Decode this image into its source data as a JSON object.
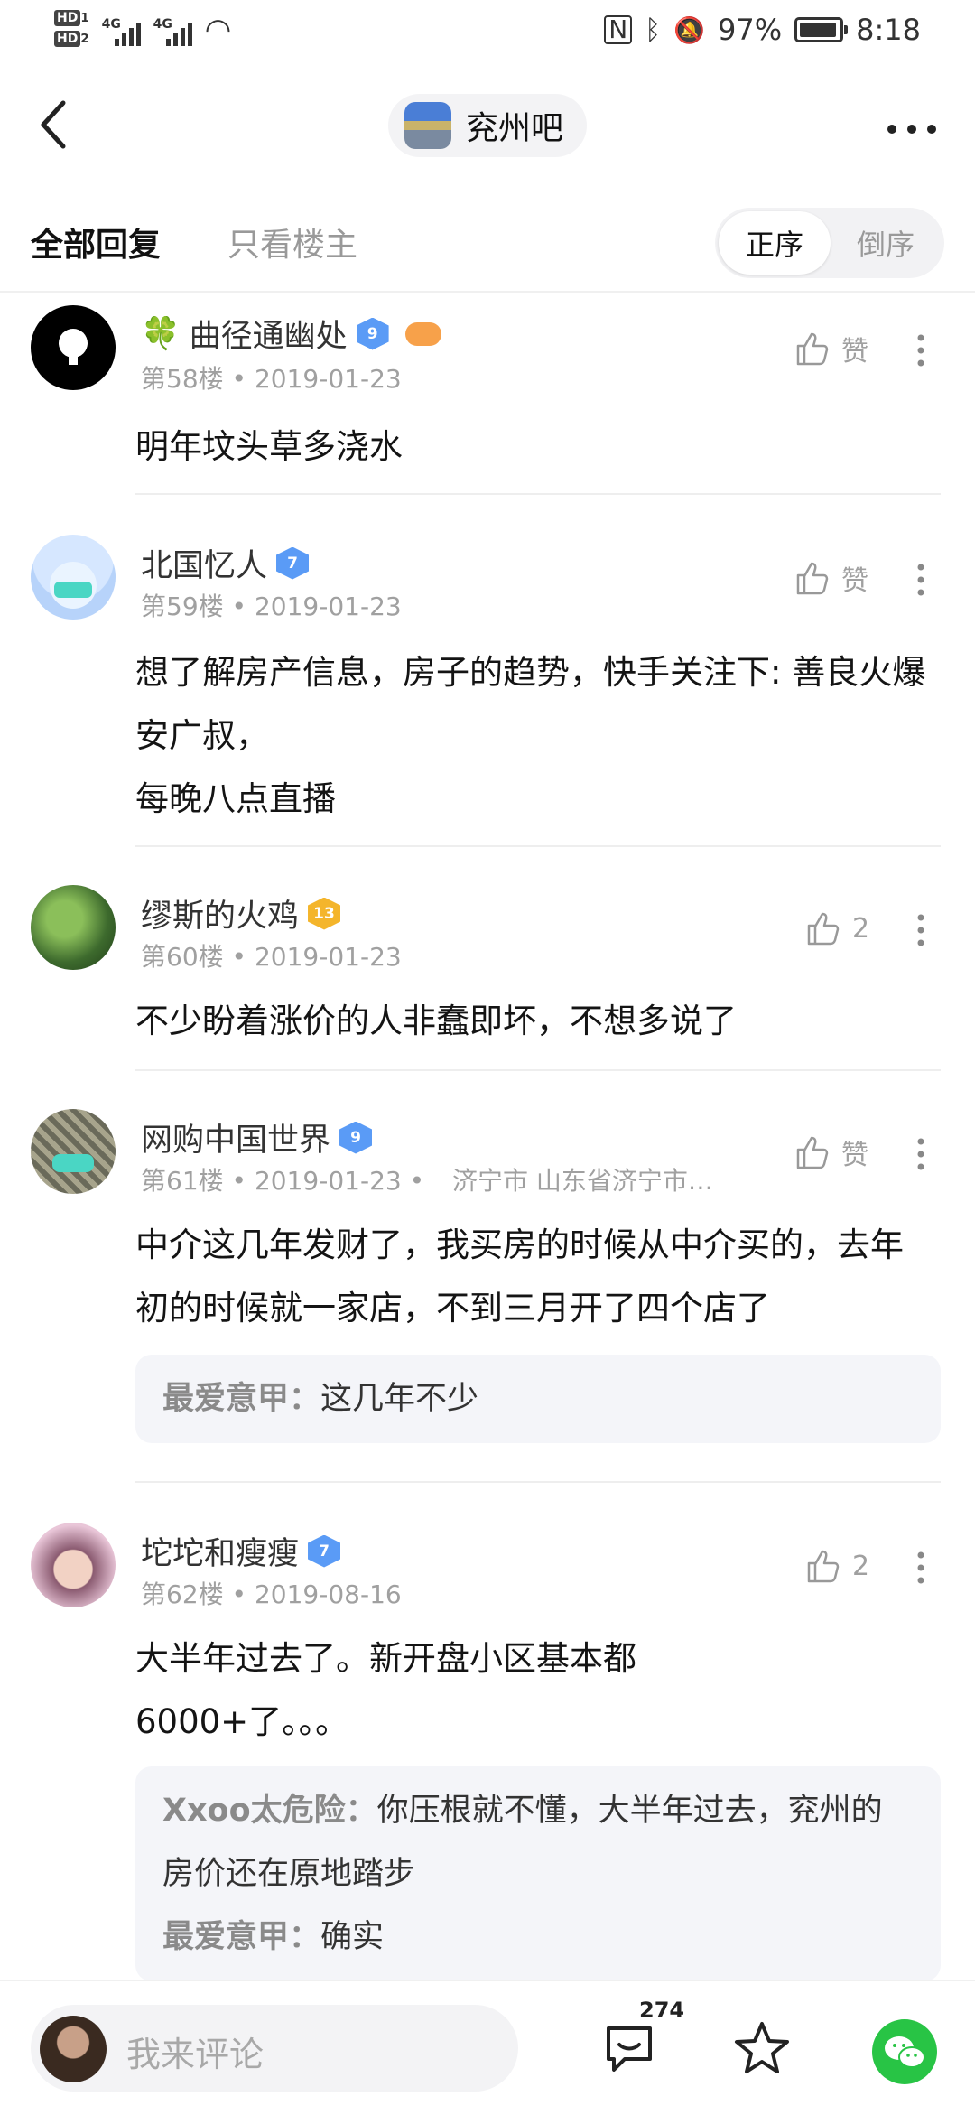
{
  "status_bar": {
    "hd1": "HD",
    "hd1_sub": "1",
    "hd2": "HD",
    "hd2_sub": "2",
    "net1": "4G",
    "net2": "4G",
    "battery": "97%",
    "time": "8:18"
  },
  "nav": {
    "forum_name": "兖州吧"
  },
  "filters": {
    "all_replies": "全部回复",
    "only_op": "只看楼主",
    "order_asc": "正序",
    "order_desc": "倒序"
  },
  "posts": [
    {
      "username": "曲径通幽处",
      "prefix": "🍀",
      "level": "9",
      "floor": "第58楼",
      "date": "2019-01-23",
      "location": "",
      "like": "赞",
      "content": "明年坟头草多浇水",
      "replies": []
    },
    {
      "username": "北国忆人",
      "level": "7",
      "floor": "第59楼",
      "date": "2019-01-23",
      "location": "",
      "like": "赞",
      "content": "想了解房产信息，房子的趋势，快手关注下: 善良火爆安广叔，\n每晚八点直播",
      "replies": []
    },
    {
      "username": "缪斯的火鸡",
      "level": "13",
      "floor": "第60楼",
      "date": "2019-01-23",
      "location": "",
      "like": "2",
      "content": "不少盼着涨价的人非蠢即坏，不想多说了",
      "replies": []
    },
    {
      "username": "网购中国世界",
      "level": "9",
      "floor": "第61楼",
      "date": "2019-01-23",
      "location": "济宁市 山东省济宁市…",
      "like": "赞",
      "content": "中介这几年发财了，我买房的时候从中介买的，去年初的时候就一家店，不到三月开了四个店了",
      "replies": [
        {
          "author": "最爱意甲：",
          "text": "这几年不少"
        }
      ]
    },
    {
      "username": "坨坨和瘦瘦",
      "level": "7",
      "floor": "第62楼",
      "date": "2019-08-16",
      "location": "",
      "like": "2",
      "content": "大半年过去了。新开盘小区基本都\n6000+了。。。",
      "replies": [
        {
          "author": "Xxoo太危险：",
          "text": "你压根就不懂，大半年过去，兖州的房价还在原地踏步"
        },
        {
          "author": "最爱意甲：",
          "text": "确实"
        }
      ]
    }
  ],
  "bottom": {
    "comment_placeholder": "我来评论",
    "reply_count": "274"
  },
  "colors": {
    "level_blue": "#5a9bf6",
    "level_gold": "#f4b52b",
    "wechat_green": "#28c445",
    "quote_bg": "#f4f5f9"
  }
}
